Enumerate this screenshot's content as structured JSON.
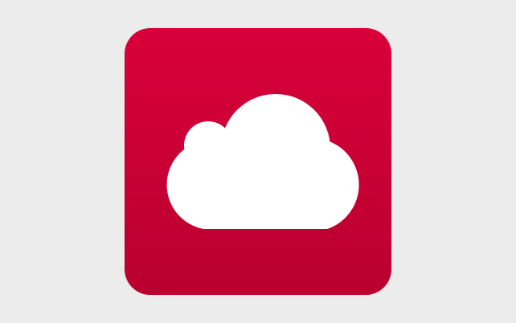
{
  "app_icon": {
    "icon": "cloud-icon",
    "background_top_color": "#d9003a",
    "background_bottom_color": "#b9002f",
    "glyph_color": "#ffffff"
  },
  "page": {
    "background_color": "#ececec"
  }
}
